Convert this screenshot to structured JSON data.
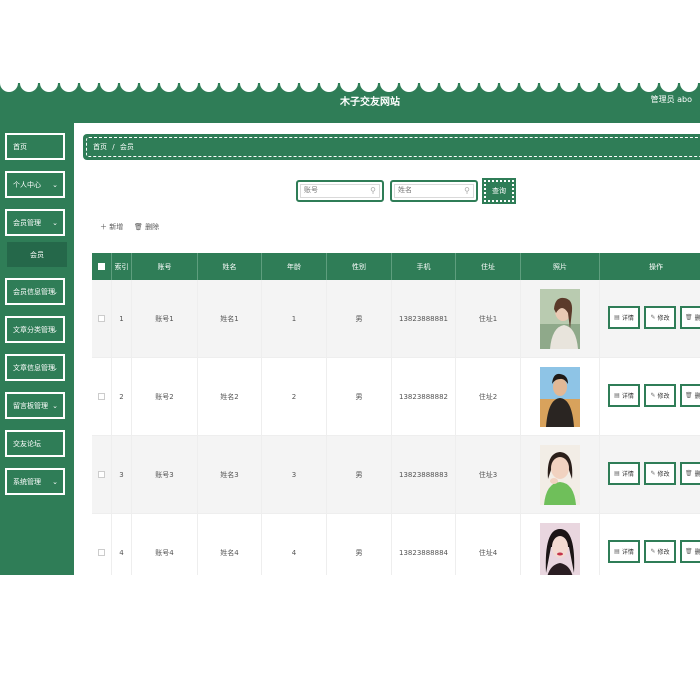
{
  "header": {
    "title": "木子交友网站",
    "user": "管理员 abo"
  },
  "sidebar": {
    "items": [
      {
        "label": "首页",
        "chevron": false
      },
      {
        "label": "个人中心",
        "chevron": true
      },
      {
        "label": "会员管理",
        "chevron": true
      },
      {
        "label": "会员信息管理",
        "chevron": true
      },
      {
        "label": "文章分类管理",
        "chevron": true
      },
      {
        "label": "文章信息管理",
        "chevron": true
      },
      {
        "label": "留言板管理",
        "chevron": true
      },
      {
        "label": "交友论坛",
        "chevron": false
      },
      {
        "label": "系统管理",
        "chevron": true
      }
    ],
    "submenu": "会员"
  },
  "breadcrumb": {
    "home": "首页",
    "sep": "/",
    "current": "会员"
  },
  "search": {
    "account_placeholder": "账号",
    "name_placeholder": "姓名",
    "query_label": "查询"
  },
  "toolbar": {
    "add_label": "新增",
    "delete_label": "删除"
  },
  "table": {
    "headers": [
      "索引",
      "账号",
      "姓名",
      "年龄",
      "性别",
      "手机",
      "住址",
      "照片",
      "操作"
    ],
    "rows": [
      {
        "index": "1",
        "account": "账号1",
        "name": "姓名1",
        "age": "1",
        "gender": "男",
        "phone": "13823888881",
        "address": "住址1"
      },
      {
        "index": "2",
        "account": "账号2",
        "name": "姓名2",
        "age": "2",
        "gender": "男",
        "phone": "13823888882",
        "address": "住址2"
      },
      {
        "index": "3",
        "account": "账号3",
        "name": "姓名3",
        "age": "3",
        "gender": "男",
        "phone": "13823888883",
        "address": "住址3"
      },
      {
        "index": "4",
        "account": "账号4",
        "name": "姓名4",
        "age": "4",
        "gender": "男",
        "phone": "13823888884",
        "address": "住址4"
      }
    ],
    "actions": {
      "detail": "详情",
      "edit": "修改",
      "delete": "删"
    }
  },
  "colors": {
    "primary": "#2f7d57",
    "sidebar_active": "#25684a",
    "row_alt": "#f4f4f4"
  },
  "icons": {
    "search": "search-icon",
    "add": "plus-icon",
    "delete": "trash-icon",
    "detail": "document-icon",
    "edit": "pencil-icon"
  }
}
